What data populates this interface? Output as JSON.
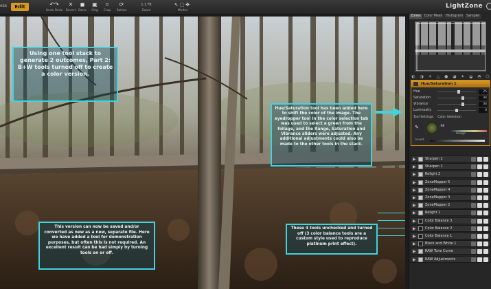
{
  "toolbar": {
    "left_label": "ess",
    "edit_label": "Edit",
    "buttons": [
      {
        "label": "Undo Redo",
        "icon": "undo-redo-icon"
      },
      {
        "label": "Revert",
        "icon": "revert-icon"
      },
      {
        "label": "Done",
        "icon": "done-icon"
      },
      {
        "label": "Orig",
        "icon": "original-icon"
      },
      {
        "label": "Crop",
        "icon": "crop-icon"
      },
      {
        "label": "Rotate",
        "icon": "rotate-icon"
      }
    ],
    "zoom_label": "Zoom",
    "zoom_value": "1:1 Fit",
    "modes_label": "Modes"
  },
  "brand": "LightZone",
  "panel_tabs": [
    "Zones",
    "Color Mask",
    "Histogram",
    "Sampler"
  ],
  "active_panel_tab": "Zones",
  "hue_tool": {
    "name": "Hue/Saturation 1",
    "sliders": [
      {
        "label": "Hue",
        "value": "25",
        "pos": 0.52
      },
      {
        "label": "Saturation",
        "value": "34",
        "pos": 0.63
      },
      {
        "label": "Vibrance",
        "value": "34",
        "pos": 0.63
      },
      {
        "label": "Luminosity",
        "value": "0",
        "pos": 0.5
      }
    ],
    "tabs": [
      "Tool Settings",
      "Color Selection"
    ],
    "range_label": "Range",
    "invert_label": "Invert",
    "range_value": ".68"
  },
  "tools": [
    {
      "name": "Sharpen 2",
      "checked": true
    },
    {
      "name": "Sharpen 1",
      "checked": true
    },
    {
      "name": "Relight 2",
      "checked": true
    },
    {
      "name": "ZoneMapper 5",
      "checked": true
    },
    {
      "name": "ZoneMapper 4",
      "checked": true
    },
    {
      "name": "ZoneMapper 3",
      "checked": true
    },
    {
      "name": "ZoneMapper 2",
      "checked": true
    },
    {
      "name": "Relight 1",
      "checked": true
    },
    {
      "name": "Color Balance 3",
      "checked": false
    },
    {
      "name": "Color Balance 2",
      "checked": false
    },
    {
      "name": "Color Balance 1",
      "checked": false
    },
    {
      "name": "Black and White 1",
      "checked": false
    },
    {
      "name": "RAW Tone Curve",
      "checked": true
    },
    {
      "name": "RAW Adjustments",
      "checked": true
    }
  ],
  "callouts": {
    "c1": "Using one tool stack to generate 2 outcomes, Part 2: B+W tools turned off to create a color version.",
    "c2": "Hue/Saturation tool has been added here to shift the color of the image. The eyedropper tool in the color selection tab was used to select a green from the foliage, and the Range, Saturation and Vibrance sliders were adjusted. Any additional adjustments could also be made to the other tools in the stack.",
    "c3": "This version can now be saved and/or converted as new as a new, separate file. Here we have added a tool for demonstration purposes, but often this is not required. An excellent result can be had simply by turning tools on or off.",
    "c4": "These 4 tools unchecked and turned off (3 color balance tools are a custom style used to reproduce platinum print effect)."
  },
  "colors": {
    "accent": "#3fd4e0",
    "brand_orange": "#d89a24",
    "panel_bg": "#262626"
  }
}
